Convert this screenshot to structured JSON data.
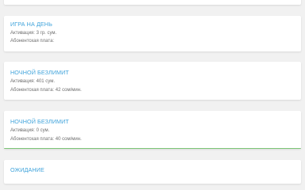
{
  "tariffs": [
    {
      "title": "Игра на день",
      "activation": "Активация: 3 гр. сум.",
      "fee": "Абонентская плата:"
    },
    {
      "title": "Ночной безлимит",
      "activation": "Активация: 401 сум.",
      "fee": "Абонентская плата: 42 сом/мин."
    },
    {
      "title": "Ночной безлимит",
      "activation": "Активация: 0 сум.",
      "fee": "Абонентская плата: 40 сом/мин."
    },
    {
      "title": "Ожидание",
      "activation": "",
      "fee": ""
    }
  ],
  "colors": {
    "title": "#3fa3db",
    "accent_border_green": "#7cc576",
    "background": "#f1f1f1"
  }
}
